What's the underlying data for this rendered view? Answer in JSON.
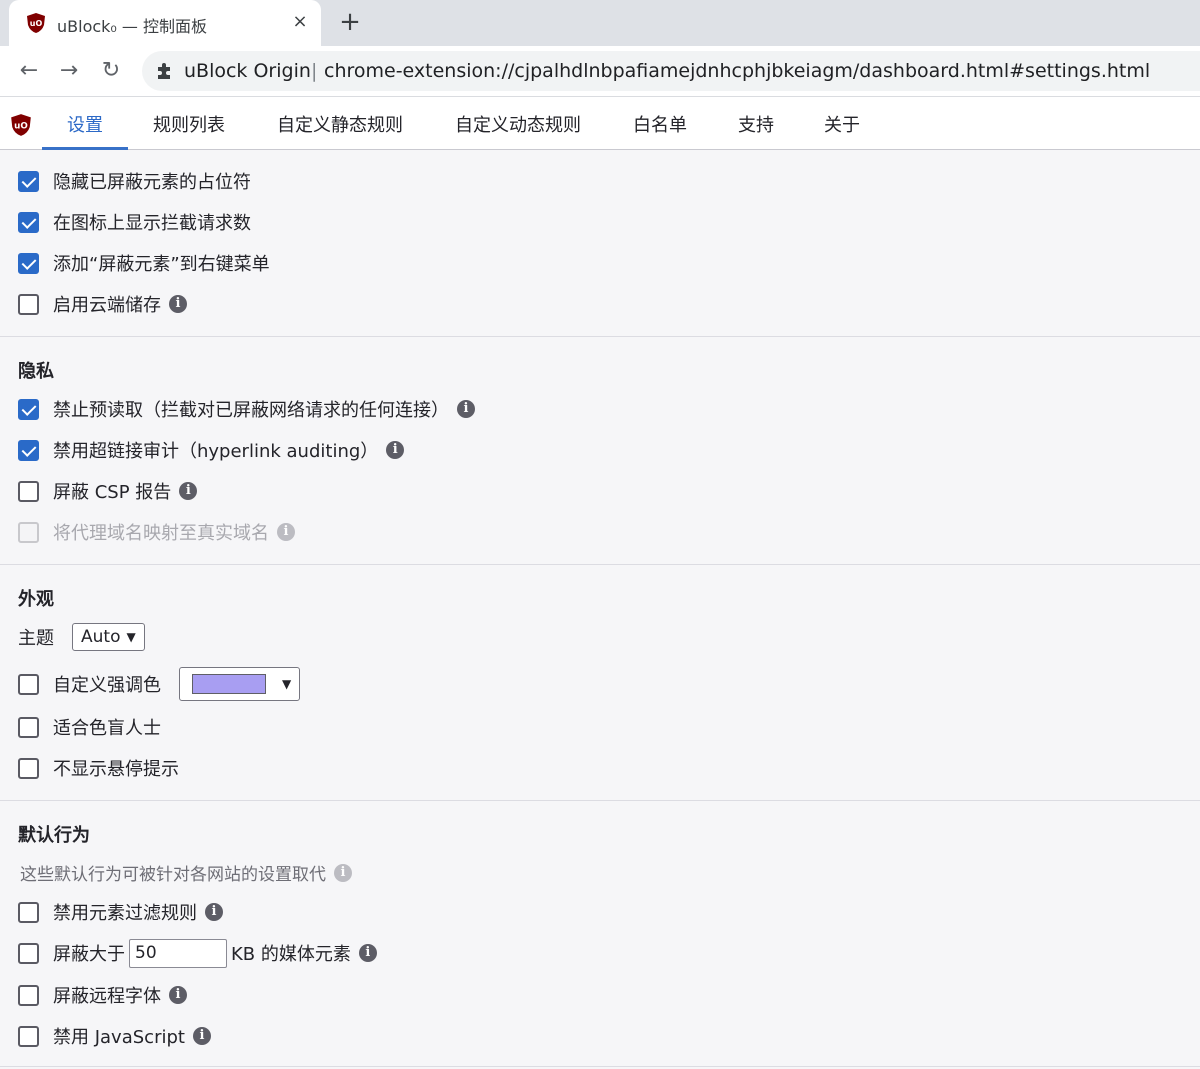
{
  "browser": {
    "tab_title": "uBlock₀ — 控制面板",
    "tab_close": "×",
    "new_tab": "+",
    "back": "←",
    "forward": "→",
    "reload": "↻",
    "extension_label": "uBlock Origin",
    "separator": "|",
    "url": "chrome-extension://cjpalhdlnbpafiamejdnhcphjbkeiagm/dashboard.html#settings.html"
  },
  "nav": {
    "tabs": [
      "设置",
      "规则列表",
      "自定义静态规则",
      "自定义动态规则",
      "白名单",
      "支持",
      "关于"
    ],
    "active_index": 0
  },
  "general": {
    "items": [
      {
        "label": "隐藏已屏蔽元素的占位符",
        "checked": true
      },
      {
        "label": "在图标上显示拦截请求数",
        "checked": true
      },
      {
        "label": "添加“屏蔽元素”到右键菜单",
        "checked": true
      },
      {
        "label": "启用云端储存",
        "checked": false
      }
    ]
  },
  "privacy": {
    "title": "隐私",
    "items": [
      {
        "label": "禁止预读取（拦截对已屏蔽网络请求的任何连接）",
        "checked": true
      },
      {
        "label": "禁用超链接审计（hyperlink auditing）",
        "checked": true
      },
      {
        "label": "屏蔽 CSP 报告",
        "checked": false
      },
      {
        "label": "将代理域名映射至真实域名",
        "checked": false,
        "disabled": true
      }
    ]
  },
  "appearance": {
    "title": "外观",
    "theme_label": "主题",
    "theme_value": "Auto",
    "accent_label": "自定义强调色",
    "accent_color": "#a89ef2",
    "colorblind_label": "适合色盲人士",
    "no_tooltips_label": "不显示悬停提示"
  },
  "defaults": {
    "title": "默认行为",
    "note": "这些默认行为可被针对各网站的设置取代",
    "cosmetic_label": "禁用元素过滤规则",
    "media_prefix": "屏蔽大于",
    "media_value": "50",
    "media_suffix": "KB 的媒体元素",
    "fonts_label": "屏蔽远程字体",
    "js_label": "禁用 JavaScript"
  },
  "info_glyph": "i",
  "colors": {
    "accent": "#2a6ac8",
    "active_tab": "#2c69c7",
    "brand": "#800000"
  }
}
